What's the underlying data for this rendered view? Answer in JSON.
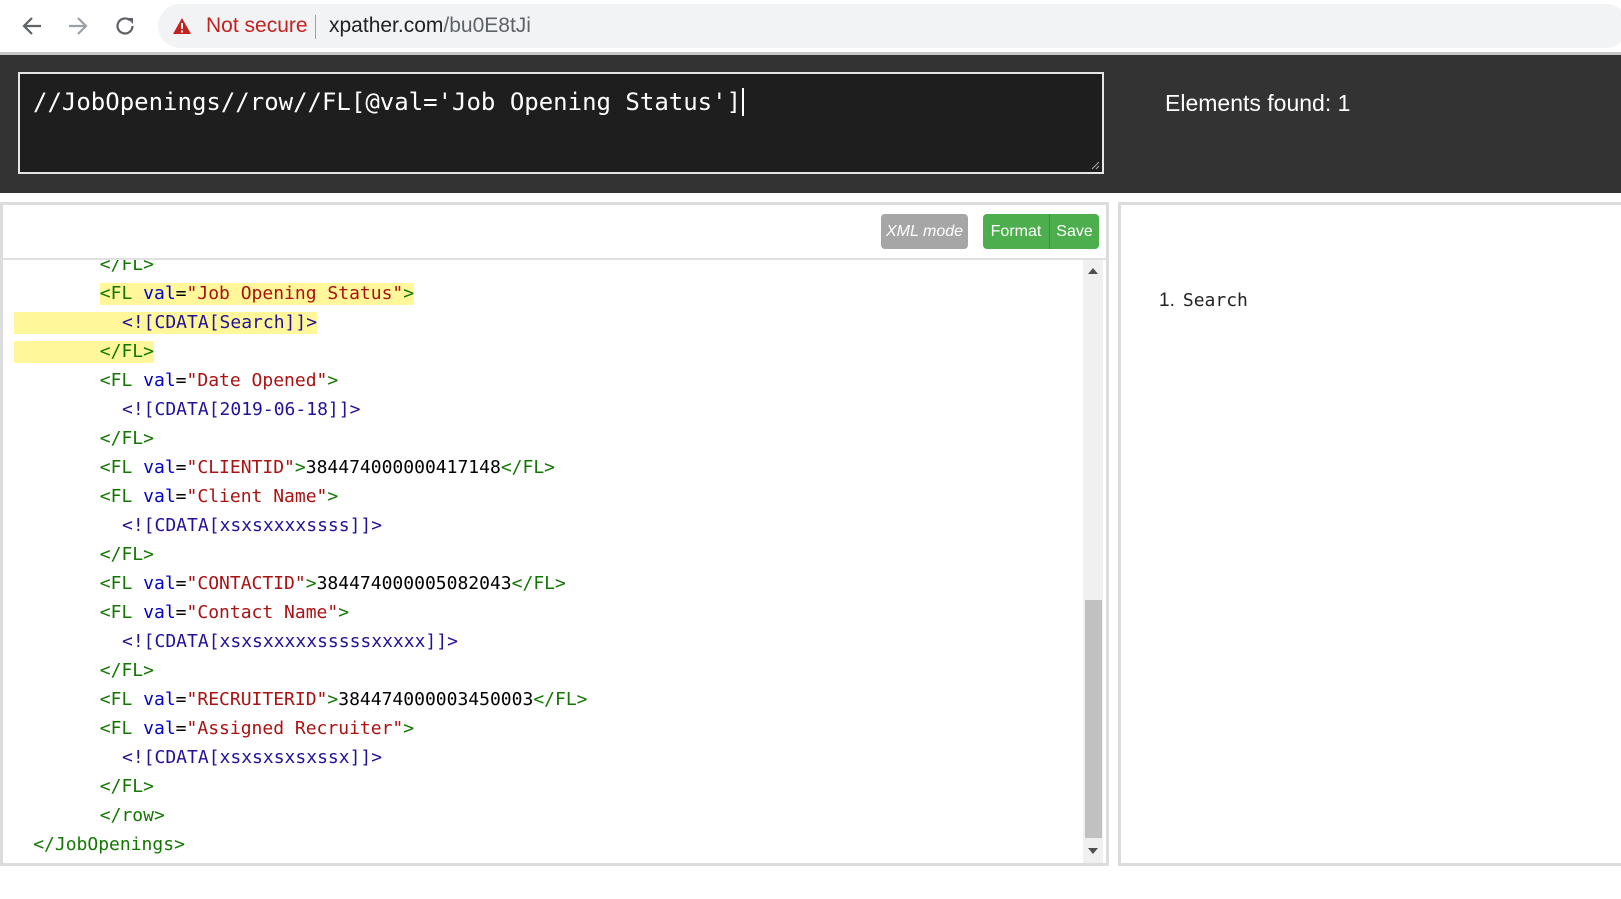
{
  "browser": {
    "security_label": "Not secure",
    "url_host": "xpather.com",
    "url_path": "/bu0E8tJi"
  },
  "xpath": {
    "query": "//JobOpenings//row//FL[@val='Job Opening Status']",
    "elements_found": "Elements found: 1"
  },
  "toolbar": {
    "xml_mode_label": "XML mode",
    "format_label": "Format",
    "save_label": "Save"
  },
  "code_lines": [
    {
      "indent": 8,
      "highlight": "none",
      "tokens": [
        {
          "t": "tag",
          "v": "</FL>"
        }
      ]
    },
    {
      "indent": 8,
      "highlight": "tag",
      "tokens": [
        {
          "t": "tag",
          "v": "<FL "
        },
        {
          "t": "attr",
          "v": "val"
        },
        {
          "t": "txt",
          "v": "="
        },
        {
          "t": "str",
          "v": "\"Job Opening Status\""
        },
        {
          "t": "tag",
          "v": ">"
        }
      ]
    },
    {
      "indent": 10,
      "highlight": "line",
      "tokens": [
        {
          "t": "cdata",
          "v": "<![CDATA[Search]]>"
        }
      ]
    },
    {
      "indent": 8,
      "highlight": "line",
      "tokens": [
        {
          "t": "tag",
          "v": "</FL>"
        }
      ]
    },
    {
      "indent": 8,
      "highlight": "none",
      "tokens": [
        {
          "t": "tag",
          "v": "<FL "
        },
        {
          "t": "attr",
          "v": "val"
        },
        {
          "t": "txt",
          "v": "="
        },
        {
          "t": "str",
          "v": "\"Date Opened\""
        },
        {
          "t": "tag",
          "v": ">"
        }
      ]
    },
    {
      "indent": 10,
      "highlight": "none",
      "tokens": [
        {
          "t": "cdata",
          "v": "<![CDATA[2019-06-18]]>"
        }
      ]
    },
    {
      "indent": 8,
      "highlight": "none",
      "tokens": [
        {
          "t": "tag",
          "v": "</FL>"
        }
      ]
    },
    {
      "indent": 8,
      "highlight": "none",
      "tokens": [
        {
          "t": "tag",
          "v": "<FL "
        },
        {
          "t": "attr",
          "v": "val"
        },
        {
          "t": "txt",
          "v": "="
        },
        {
          "t": "str",
          "v": "\"CLIENTID\""
        },
        {
          "t": "tag",
          "v": ">"
        },
        {
          "t": "txt",
          "v": "384474000000417148"
        },
        {
          "t": "tag",
          "v": "</FL>"
        }
      ]
    },
    {
      "indent": 8,
      "highlight": "none",
      "tokens": [
        {
          "t": "tag",
          "v": "<FL "
        },
        {
          "t": "attr",
          "v": "val"
        },
        {
          "t": "txt",
          "v": "="
        },
        {
          "t": "str",
          "v": "\"Client Name\""
        },
        {
          "t": "tag",
          "v": ">"
        }
      ]
    },
    {
      "indent": 10,
      "highlight": "none",
      "tokens": [
        {
          "t": "cdata",
          "v": "<![CDATA[xsxsxxxxssss]]>"
        }
      ]
    },
    {
      "indent": 8,
      "highlight": "none",
      "tokens": [
        {
          "t": "tag",
          "v": "</FL>"
        }
      ]
    },
    {
      "indent": 8,
      "highlight": "none",
      "tokens": [
        {
          "t": "tag",
          "v": "<FL "
        },
        {
          "t": "attr",
          "v": "val"
        },
        {
          "t": "txt",
          "v": "="
        },
        {
          "t": "str",
          "v": "\"CONTACTID\""
        },
        {
          "t": "tag",
          "v": ">"
        },
        {
          "t": "txt",
          "v": "384474000005082043"
        },
        {
          "t": "tag",
          "v": "</FL>"
        }
      ]
    },
    {
      "indent": 8,
      "highlight": "none",
      "tokens": [
        {
          "t": "tag",
          "v": "<FL "
        },
        {
          "t": "attr",
          "v": "val"
        },
        {
          "t": "txt",
          "v": "="
        },
        {
          "t": "str",
          "v": "\"Contact Name\""
        },
        {
          "t": "tag",
          "v": ">"
        }
      ]
    },
    {
      "indent": 10,
      "highlight": "none",
      "tokens": [
        {
          "t": "cdata",
          "v": "<![CDATA[xsxsxxxxxsssssxxxxx]]>"
        }
      ]
    },
    {
      "indent": 8,
      "highlight": "none",
      "tokens": [
        {
          "t": "tag",
          "v": "</FL>"
        }
      ]
    },
    {
      "indent": 8,
      "highlight": "none",
      "tokens": [
        {
          "t": "tag",
          "v": "<FL "
        },
        {
          "t": "attr",
          "v": "val"
        },
        {
          "t": "txt",
          "v": "="
        },
        {
          "t": "str",
          "v": "\"RECRUITERID\""
        },
        {
          "t": "tag",
          "v": ">"
        },
        {
          "t": "txt",
          "v": "384474000003450003"
        },
        {
          "t": "tag",
          "v": "</FL>"
        }
      ]
    },
    {
      "indent": 8,
      "highlight": "none",
      "tokens": [
        {
          "t": "tag",
          "v": "<FL "
        },
        {
          "t": "attr",
          "v": "val"
        },
        {
          "t": "txt",
          "v": "="
        },
        {
          "t": "str",
          "v": "\"Assigned Recruiter\""
        },
        {
          "t": "tag",
          "v": ">"
        }
      ]
    },
    {
      "indent": 10,
      "highlight": "none",
      "tokens": [
        {
          "t": "cdata",
          "v": "<![CDATA[xsxsxsxsxssx]]>"
        }
      ]
    },
    {
      "indent": 8,
      "highlight": "none",
      "tokens": [
        {
          "t": "tag",
          "v": "</FL>"
        }
      ]
    },
    {
      "indent": 8,
      "highlight": "none",
      "tokens": [
        {
          "t": "tag",
          "v": "</row>"
        }
      ]
    },
    {
      "indent": 2,
      "highlight": "none",
      "tokens": [
        {
          "t": "tag",
          "v": "</JobOpenings>"
        }
      ]
    }
  ],
  "results": [
    {
      "number": "1.",
      "value": "Search"
    }
  ],
  "colors": {
    "tag": "#117700",
    "attribute": "#0000cc",
    "string": "#aa1111",
    "cdata": "#221199",
    "highlight": "#fff799",
    "button_green": "#4cae4c"
  },
  "icons": [
    "back-arrow-icon",
    "forward-arrow-icon",
    "reload-icon",
    "warning-icon",
    "resize-grip-icon"
  ]
}
